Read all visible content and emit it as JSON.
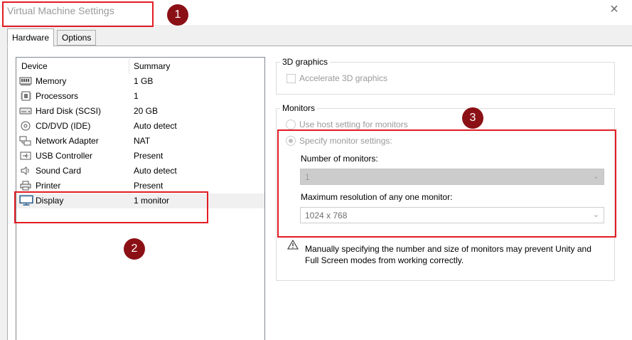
{
  "window": {
    "title": "Virtual Machine Settings",
    "close_glyph": "×"
  },
  "tabs": [
    {
      "label": "Hardware"
    },
    {
      "label": "Options"
    }
  ],
  "device_list": {
    "columns": {
      "device": "Device",
      "summary": "Summary"
    },
    "rows": [
      {
        "device": "Memory",
        "summary": "1 GB",
        "icon": "memory-icon"
      },
      {
        "device": "Processors",
        "summary": "1",
        "icon": "processor-icon"
      },
      {
        "device": "Hard Disk (SCSI)",
        "summary": "20 GB",
        "icon": "hard-disk-icon"
      },
      {
        "device": "CD/DVD (IDE)",
        "summary": "Auto detect",
        "icon": "cd-dvd-icon"
      },
      {
        "device": "Network Adapter",
        "summary": "NAT",
        "icon": "network-adapter-icon"
      },
      {
        "device": "USB Controller",
        "summary": "Present",
        "icon": "usb-icon"
      },
      {
        "device": "Sound Card",
        "summary": "Auto detect",
        "icon": "speaker-icon"
      },
      {
        "device": "Printer",
        "summary": "Present",
        "icon": "printer-icon"
      },
      {
        "device": "Display",
        "summary": "1 monitor",
        "icon": "monitor-icon",
        "selected": true
      }
    ]
  },
  "graphics_3d": {
    "legend": "3D graphics",
    "accelerate_label": "Accelerate 3D graphics",
    "accelerate_checked": false
  },
  "monitors": {
    "legend": "Monitors",
    "use_host_label": "Use host setting for monitors",
    "specify_label": "Specify monitor settings:",
    "selected_option": "specify",
    "number_label": "Number of monitors:",
    "number_value": "1",
    "resolution_label": "Maximum resolution of any one monitor:",
    "resolution_value": "1024 x 768",
    "warning": "Manually specifying the number and size of monitors may prevent Unity and Full Screen modes from working correctly."
  },
  "annotations": [
    {
      "number": "1"
    },
    {
      "number": "2"
    },
    {
      "number": "3"
    }
  ],
  "colors": {
    "annotation_red": "#e21c24",
    "badge_fill": "#8b1016",
    "selection": "#f0f0f0"
  }
}
